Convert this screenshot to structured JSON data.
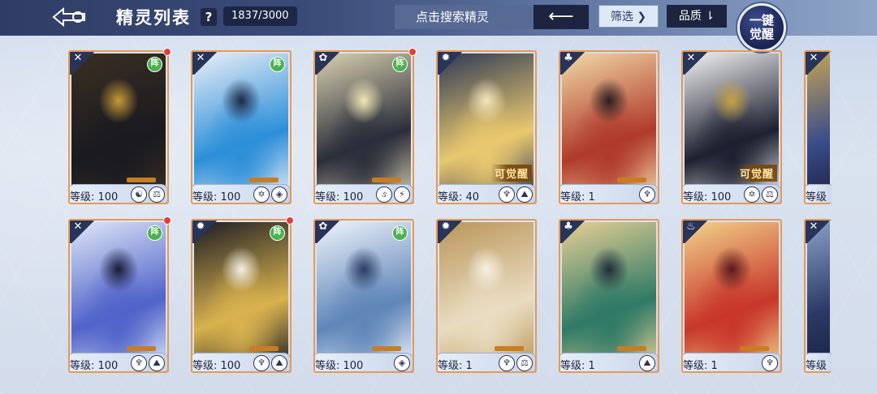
{
  "header": {
    "title": "精灵列表",
    "help": "?",
    "count": "1837/3000",
    "search_placeholder": "点击搜索精灵",
    "search_go": "⟵",
    "filter_label": "筛选 ❯",
    "sort_label": "品质 ⇂",
    "awaken_line1": "一键",
    "awaken_line2": "觉醒"
  },
  "colors": {
    "accent": "#e69a54",
    "navy": "#283459",
    "formation_green": "#4cb24e",
    "alert_red": "#e23d3d"
  },
  "cards": [
    {
      "level": "等级: 100",
      "element": "dark",
      "elem_glyph": "✕",
      "formation": "阵",
      "alert": true,
      "awaken_tag": "",
      "badges": [
        "☯",
        "⚖"
      ],
      "palette": [
        "#1a1a1f",
        "#3a2f24",
        "#c79a3a"
      ]
    },
    {
      "level": "等级: 100",
      "element": "dark",
      "elem_glyph": "✕",
      "formation": "阵",
      "alert": false,
      "awaken_tag": "",
      "badges": [
        "✡",
        "◈"
      ],
      "palette": [
        "#2c8fd8",
        "#e9eef7",
        "#1b2a4a"
      ]
    },
    {
      "level": "等级: 100",
      "element": "light",
      "elem_glyph": "✿",
      "formation": "阵",
      "alert": true,
      "awaken_tag": "",
      "badges": [
        "ઙ",
        "⚡"
      ],
      "palette": [
        "#2a2e3a",
        "#d8d0b0",
        "#f3e7b4"
      ]
    },
    {
      "level": "等级: 40",
      "element": "holy",
      "elem_glyph": "✹",
      "formation": "",
      "alert": false,
      "awaken_tag": "可觉醒",
      "badges": [
        "♆",
        "⛰"
      ],
      "palette": [
        "#e9c86e",
        "#2e3a55",
        "#f4e4bd"
      ]
    },
    {
      "level": "等级: 1",
      "element": "nature",
      "elem_glyph": "♣",
      "formation": "",
      "alert": false,
      "awaken_tag": "",
      "badges": [
        "♆"
      ],
      "palette": [
        "#b03a2a",
        "#f0d9a6",
        "#2a2020"
      ]
    },
    {
      "level": "等级: 100",
      "element": "dark",
      "elem_glyph": "✕",
      "formation": "",
      "alert": false,
      "awaken_tag": "可觉醒",
      "badges": [
        "✡",
        "⚖"
      ],
      "palette": [
        "#1d2030",
        "#f2f2f2",
        "#c9a445"
      ]
    },
    {
      "level": "等级: 100",
      "element": "dark",
      "elem_glyph": "✕",
      "formation": "阵",
      "alert": true,
      "awaken_tag": "",
      "badges": [
        "♆",
        "⛰"
      ],
      "palette": [
        "#4f63c9",
        "#dfe6f7",
        "#1a1c3a"
      ]
    },
    {
      "level": "等级: 100",
      "element": "holy",
      "elem_glyph": "✹",
      "formation": "阵",
      "alert": true,
      "awaken_tag": "",
      "badges": [
        "♆",
        "⛰"
      ],
      "palette": [
        "#d9b24e",
        "#1d1d24",
        "#f2efe5"
      ]
    },
    {
      "level": "等级: 100",
      "element": "light",
      "elem_glyph": "✿",
      "formation": "阵",
      "alert": false,
      "awaken_tag": "",
      "badges": [
        "◈"
      ],
      "palette": [
        "#5f86b8",
        "#eef3fb",
        "#2b3d63"
      ]
    },
    {
      "level": "等级: 1",
      "element": "holy",
      "elem_glyph": "✹",
      "formation": "",
      "alert": false,
      "awaken_tag": "",
      "badges": [
        "♆",
        "⚖"
      ],
      "palette": [
        "#e9dcc0",
        "#b9965a",
        "#f6efe2"
      ]
    },
    {
      "level": "等级: 1",
      "element": "nature",
      "elem_glyph": "♣",
      "formation": "",
      "alert": false,
      "awaken_tag": "",
      "badges": [
        "⛰"
      ],
      "palette": [
        "#2f7a66",
        "#e6cf94",
        "#1e2f3a"
      ]
    },
    {
      "level": "等级: 1",
      "element": "fire",
      "elem_glyph": "♨",
      "formation": "",
      "alert": false,
      "awaken_tag": "",
      "badges": [
        "♆"
      ],
      "palette": [
        "#c8362a",
        "#f1d28a",
        "#5a1a1a"
      ]
    }
  ],
  "partial_cards": [
    {
      "level": "等级",
      "palette": [
        "#3a4c8a",
        "#c4a454",
        "#1b2240"
      ]
    },
    {
      "level": "等级",
      "palette": [
        "#2b3a66",
        "#8aa0c8",
        "#1b2240"
      ]
    }
  ]
}
